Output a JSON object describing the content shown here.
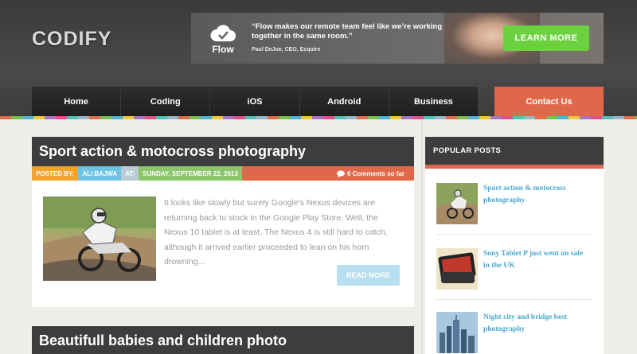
{
  "site": {
    "logo": "CODIFY"
  },
  "banner": {
    "brand": "Flow",
    "quote": "“Flow makes our remote team feel like we’re working together in the same room.”",
    "author": "Paul DeJoe, CEO, Ecquire",
    "cta_label": "LEARN MORE"
  },
  "nav": {
    "items": [
      {
        "label": "Home"
      },
      {
        "label": "Coding"
      },
      {
        "label": "iOS"
      },
      {
        "label": "Android"
      },
      {
        "label": "Business"
      }
    ],
    "contact_label": "Contact Us"
  },
  "posts": [
    {
      "title": "Sport action & motocross photography",
      "meta": {
        "posted_by_label": "POSTED BY:",
        "author": "ALI BAJWA",
        "at_label": "AT:",
        "date": "SUNDAY, SEPTEMBER 22, 2013",
        "comments": "6 Comments so far"
      },
      "excerpt": "It looks like slowly but surely Google's Nexus devices are returning back to stock in the Google Play Store. Well, the Nexus 10 tablet is at least. The Nexus 4 is still hard to catch, although it arrived earlier proceeded to lean on his horn drowning...",
      "read_more_label": "READ MORE"
    },
    {
      "title": "Beautifull babies and children photo"
    }
  ],
  "sidebar": {
    "heading": "POPULAR POSTS",
    "items": [
      {
        "title": "Sport action & motocross photography"
      },
      {
        "title": "Sony Tablet P just went on sale in the UK"
      },
      {
        "title": "Night city and bridge best photography"
      }
    ]
  },
  "colors": {
    "accent": "#e0684a",
    "dark": "#3d3d3d",
    "link": "#4aa8d0",
    "cta_green": "#6bd13f"
  }
}
